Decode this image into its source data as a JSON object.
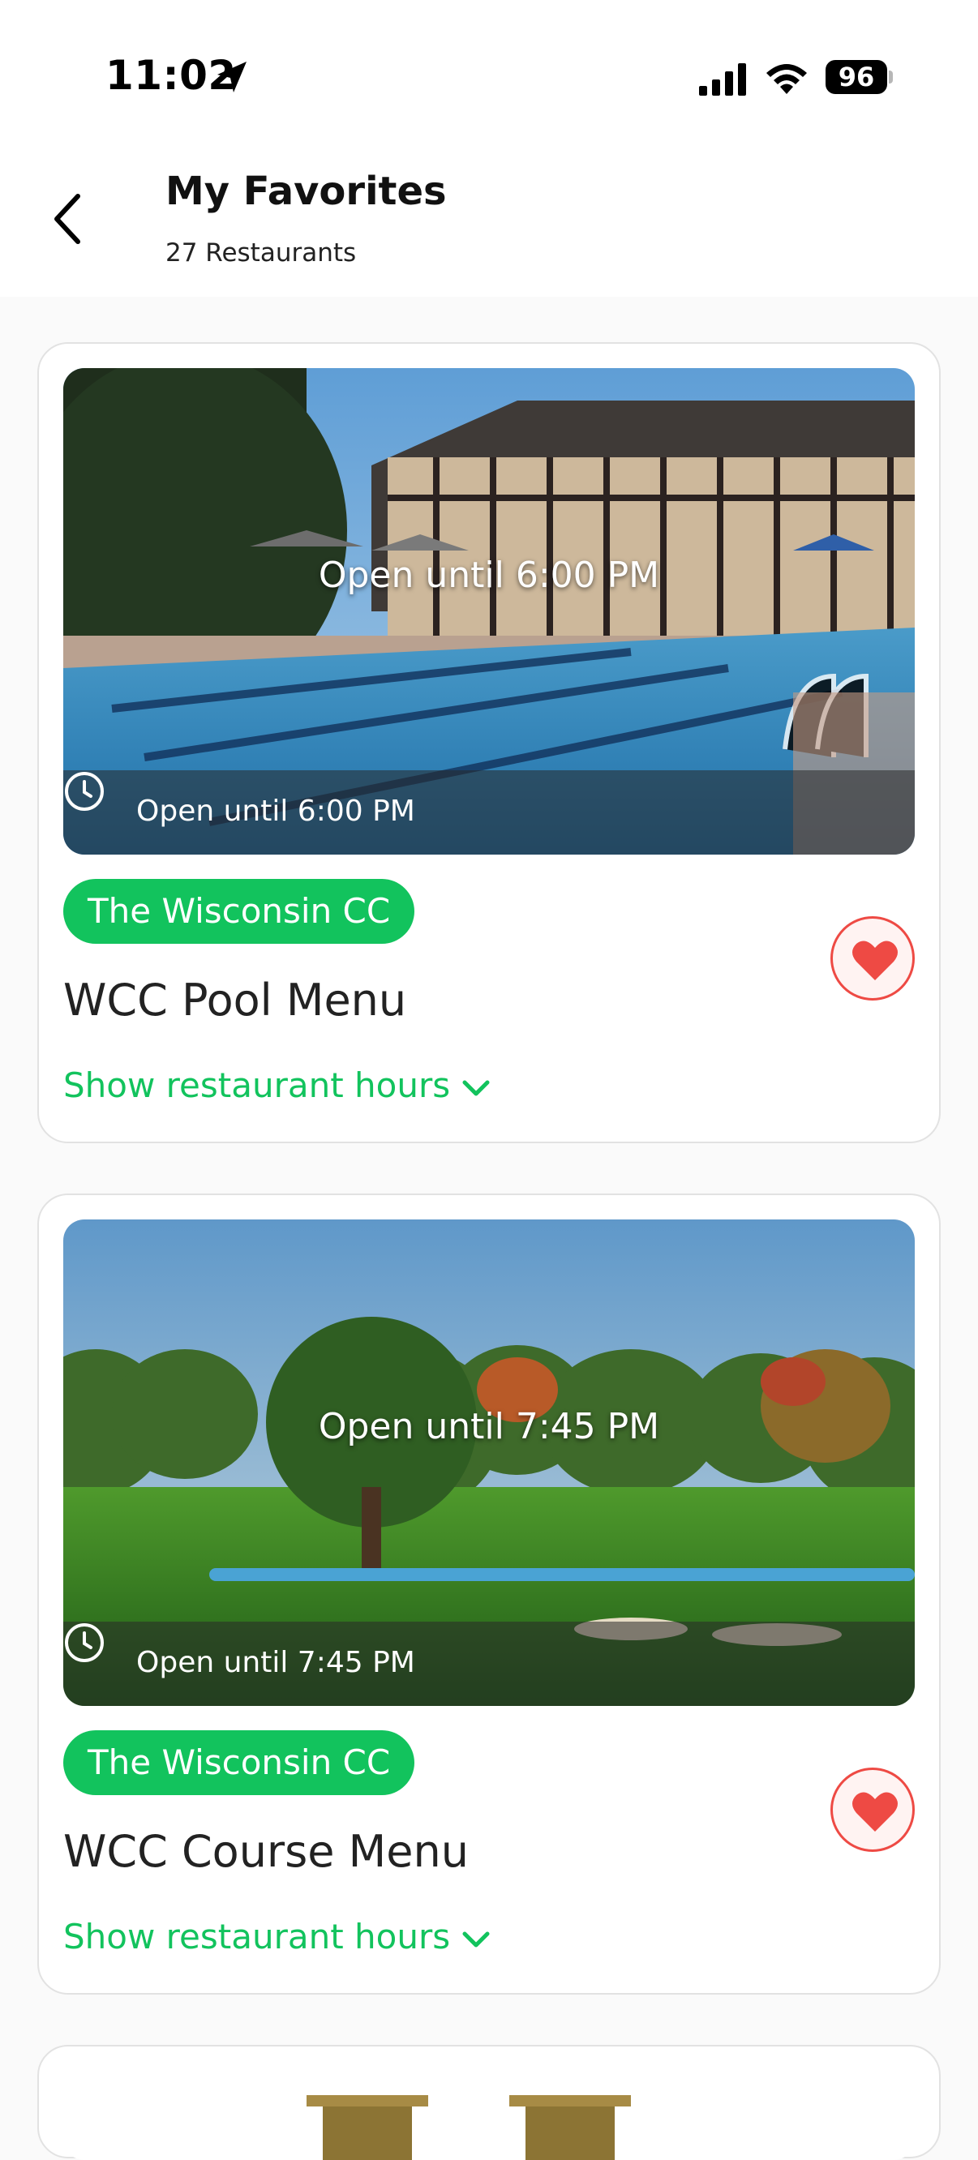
{
  "status_bar": {
    "time": "11:02",
    "battery": "96"
  },
  "header": {
    "title": "My Favorites",
    "subtitle": "27 Restaurants"
  },
  "colors": {
    "accent": "#12c35d",
    "favorite": "#ee4a44"
  },
  "restaurants": [
    {
      "image": "pool-photo",
      "overlay_text": "Open until 6:00 PM",
      "hours_text": "Open until 6:00 PM",
      "club": "The Wisconsin CC",
      "name": "WCC Pool Menu",
      "hours_toggle": "Show restaurant hours",
      "favorited": true
    },
    {
      "image": "golf-course-photo",
      "overlay_text": "Open until 7:45 PM",
      "hours_text": "Open until 7:45 PM",
      "club": "The Wisconsin CC",
      "name": "WCC Course Menu",
      "hours_toggle": "Show restaurant hours",
      "favorited": true
    }
  ]
}
